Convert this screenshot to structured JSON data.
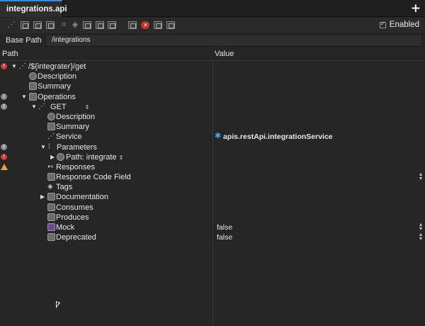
{
  "tab": {
    "title": "integrations.api",
    "icon": "api-file-icon"
  },
  "toolbar": {
    "enabled_label": "Enabled",
    "enabled_checked": true
  },
  "base_path": {
    "label": "Base Path",
    "value": "/integrations"
  },
  "columns": {
    "path": "Path",
    "value": "Value"
  },
  "tree": {
    "root": {
      "label": "/${integrater}/get"
    },
    "description": "Description",
    "summary": "Summary",
    "operations": "Operations",
    "get": "GET",
    "get_description": "Description",
    "get_summary": "Summary",
    "service": {
      "label": "Service",
      "value": "apis.restApi.integrationService"
    },
    "parameters": "Parameters",
    "path_param": {
      "label": "Path:",
      "name": "integrate"
    },
    "responses": "Responses",
    "response_code_field": "Response Code Field",
    "tags": "Tags",
    "documentation": "Documentation",
    "consumes": "Consumes",
    "produces": "Produces",
    "mock": {
      "label": "Mock",
      "value": "false"
    },
    "deprecated": {
      "label": "Deprecated",
      "value": "false"
    }
  },
  "colors": {
    "accent": "#3b8ad8",
    "error": "#cc3b33",
    "warning": "#e6a33c",
    "service_icon": "#4aa3e8"
  }
}
